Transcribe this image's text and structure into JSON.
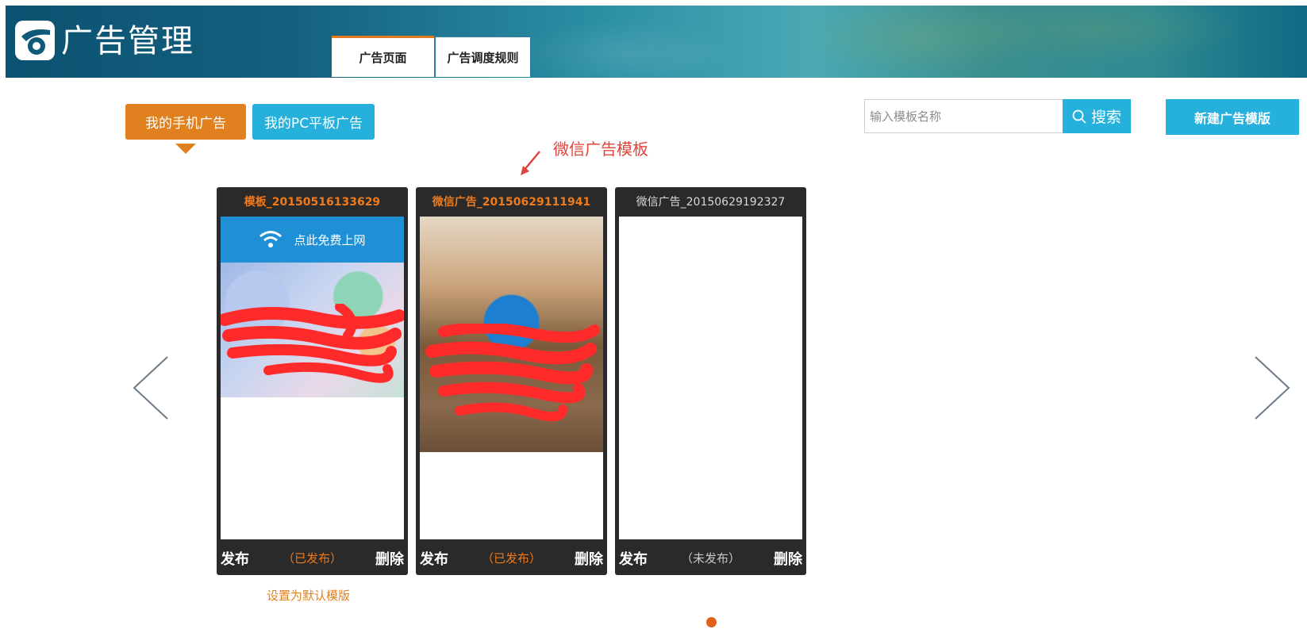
{
  "header": {
    "app_title": "广告管理",
    "tabs": [
      {
        "label": "广告页面",
        "active": true
      },
      {
        "label": "广告调度规则",
        "active": false
      }
    ]
  },
  "subtabs": [
    {
      "label": "我的手机广告",
      "active": true
    },
    {
      "label": "我的PC平板广告",
      "active": false
    }
  ],
  "search": {
    "placeholder": "输入模板名称",
    "value": "",
    "button_label": "搜索",
    "icon": "search-icon"
  },
  "new_template_button": "新建广告模版",
  "annotation": "微信广告模板",
  "cards": [
    {
      "title": "模板_20150516133629",
      "title_active": true,
      "wifi_text": "点此免费上网",
      "publish_label": "发布",
      "status": "（已发布）",
      "delete_label": "删除"
    },
    {
      "title": "微信广告_20150629111941",
      "title_active": true,
      "publish_label": "发布",
      "status": "（已发布）",
      "delete_label": "删除"
    },
    {
      "title": "微信广告_20150629192327",
      "title_active": false,
      "publish_label": "发布",
      "status": "（未发布）",
      "delete_label": "删除"
    }
  ],
  "default_link": "设置为默认模版",
  "colors": {
    "accent_orange": "#e0801f",
    "accent_blue": "#26b0dc",
    "annotation_red": "#e0443a"
  }
}
